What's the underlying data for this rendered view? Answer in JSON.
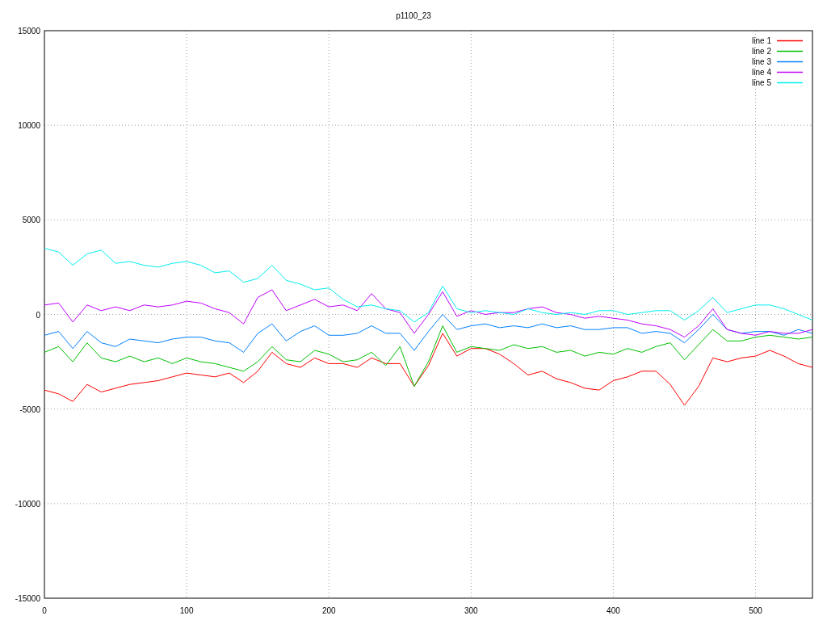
{
  "chart_data": {
    "type": "line",
    "title": "p1100_23",
    "grid": true,
    "legend": true,
    "xlim": [
      0,
      540
    ],
    "ylim": [
      -15000,
      15000
    ],
    "xticks": [
      0,
      100,
      200,
      300,
      400,
      500
    ],
    "yticks": [
      -15000,
      -10000,
      -5000,
      0,
      5000,
      10000,
      15000
    ],
    "x": [
      0,
      10,
      20,
      30,
      40,
      50,
      60,
      70,
      80,
      90,
      100,
      110,
      120,
      130,
      140,
      150,
      160,
      170,
      180,
      190,
      200,
      210,
      220,
      230,
      240,
      250,
      260,
      270,
      280,
      290,
      300,
      310,
      320,
      330,
      340,
      350,
      360,
      370,
      380,
      390,
      400,
      410,
      420,
      430,
      440,
      450,
      460,
      470,
      480,
      490,
      500,
      510,
      520,
      530,
      540
    ],
    "series": [
      {
        "name": "line 1",
        "color": "#ff0000",
        "values": [
          -4000,
          -4200,
          -4600,
          -3700,
          -4100,
          -3900,
          -3700,
          -3600,
          -3500,
          -3300,
          -3100,
          -3200,
          -3300,
          -3100,
          -3600,
          -3000,
          -2000,
          -2600,
          -2800,
          -2300,
          -2600,
          -2600,
          -2800,
          -2300,
          -2600,
          -2600,
          -3800,
          -2700,
          -1000,
          -2200,
          -1800,
          -1800,
          -2100,
          -2600,
          -3200,
          -3000,
          -3400,
          -3600,
          -3900,
          -4000,
          -3500,
          -3300,
          -3000,
          -3000,
          -3700,
          -4800,
          -3800,
          -2300,
          -2500,
          -2300,
          -2200,
          -1900,
          -2200,
          -2600,
          -2800
        ]
      },
      {
        "name": "line 2",
        "color": "#00c000",
        "values": [
          -2000,
          -1700,
          -2500,
          -1500,
          -2300,
          -2500,
          -2200,
          -2500,
          -2300,
          -2600,
          -2300,
          -2500,
          -2600,
          -2800,
          -3000,
          -2500,
          -1700,
          -2400,
          -2500,
          -1900,
          -2100,
          -2500,
          -2400,
          -2000,
          -2700,
          -1700,
          -3800,
          -2500,
          -600,
          -2000,
          -1700,
          -1800,
          -1900,
          -1600,
          -1800,
          -1700,
          -2000,
          -1900,
          -2200,
          -2000,
          -2100,
          -1800,
          -2000,
          -1700,
          -1500,
          -2400,
          -1600,
          -800,
          -1400,
          -1400,
          -1200,
          -1100,
          -1200,
          -1300,
          -1200
        ]
      },
      {
        "name": "line 3",
        "color": "#0080ff",
        "values": [
          -1100,
          -900,
          -1800,
          -900,
          -1500,
          -1700,
          -1300,
          -1400,
          -1500,
          -1300,
          -1200,
          -1200,
          -1400,
          -1500,
          -2000,
          -1000,
          -500,
          -1400,
          -900,
          -600,
          -1100,
          -1100,
          -1000,
          -600,
          -1000,
          -1000,
          -1900,
          -900,
          0,
          -800,
          -600,
          -500,
          -700,
          -600,
          -700,
          -500,
          -700,
          -600,
          -800,
          -800,
          -700,
          -700,
          -1000,
          -900,
          -1000,
          -1500,
          -800,
          0,
          -800,
          -1000,
          -900,
          -900,
          -1100,
          -800,
          -1000
        ]
      },
      {
        "name": "line 4",
        "color": "#c000ff",
        "values": [
          500,
          600,
          -400,
          500,
          200,
          400,
          200,
          500,
          400,
          500,
          700,
          600,
          300,
          100,
          -500,
          900,
          1300,
          200,
          500,
          800,
          400,
          500,
          200,
          1100,
          300,
          100,
          -1000,
          0,
          1200,
          -100,
          200,
          0,
          100,
          100,
          300,
          400,
          100,
          0,
          -200,
          -100,
          -200,
          -300,
          -500,
          -600,
          -800,
          -1200,
          -600,
          300,
          -800,
          -1000,
          -1100,
          -900,
          -1000,
          -1000,
          -800
        ]
      },
      {
        "name": "line 5",
        "color": "#00eeee",
        "values": [
          3500,
          3300,
          2600,
          3200,
          3400,
          2700,
          2800,
          2600,
          2500,
          2700,
          2800,
          2600,
          2200,
          2300,
          1700,
          1900,
          2600,
          1800,
          1600,
          1300,
          1400,
          800,
          400,
          500,
          300,
          200,
          -400,
          100,
          1500,
          300,
          100,
          200,
          100,
          0,
          300,
          100,
          0,
          100,
          0,
          200,
          200,
          0,
          100,
          200,
          200,
          -300,
          200,
          900,
          100,
          300,
          500,
          500,
          300,
          0,
          -300
        ]
      }
    ]
  }
}
